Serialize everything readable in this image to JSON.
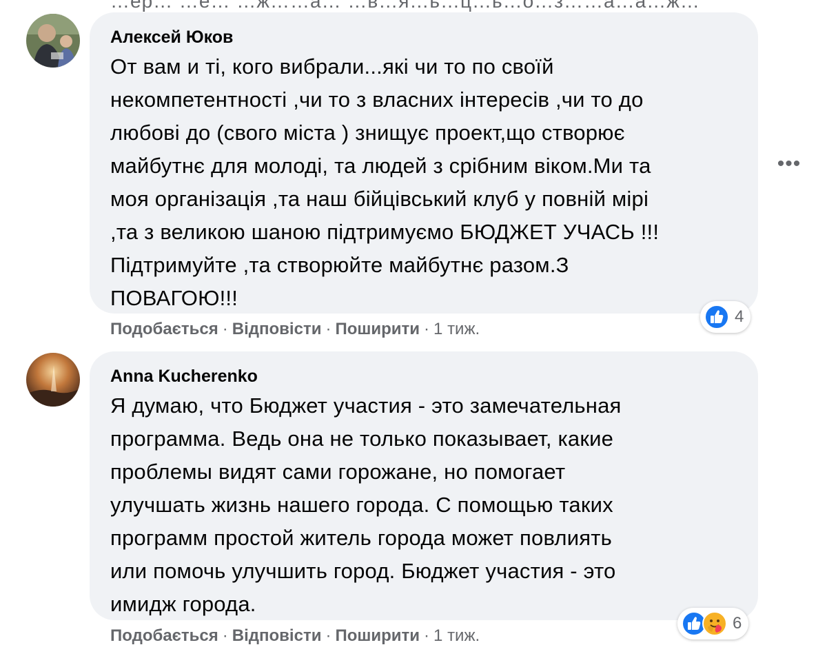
{
  "top_strip": "…ер… …е… …ж……а… …в…я…ь…ц…ь…о…з……а…а…ж…",
  "comments": [
    {
      "author": "Алексей Юков",
      "lines": [
        "От вам и ті, кого вибрали...які чи то по своїй",
        "некомпетентності ,чи то з власних інтересів ,чи то до",
        "любові до (свого міста ) знищує проект,що створює",
        "майбутнє для молоді, та людей з срібним віком.Ми та",
        "моя організація ,та наш бійцівський клуб у повній мірі",
        ",та з великою шаною підтримуємо БЮДЖЕТ УЧАСЬ !!!",
        "Підтримуйте ,та створюйте майбутнє разом.З",
        "ПОВАГОЮ!!!"
      ],
      "reaction_count": "4",
      "reaction_icons": [
        "like-icon"
      ],
      "actions": {
        "like": "Подобається",
        "reply": "Відповісти",
        "share": "Поширити",
        "separator": "·",
        "time": "1 тиж."
      }
    },
    {
      "author": "Anna Kucherenko",
      "lines": [
        "Я думаю, что Бюджет участия - это замечательная",
        "программа. Ведь она не только показывает, какие",
        "проблемы видят сами горожане, но помогает",
        "улучшать жизнь нашего города. С помощью таких",
        "программ простой житель города может повлиять",
        "или помочь улучшить город. Бюджет участия - это",
        "имидж города."
      ],
      "reaction_count": "6",
      "reaction_icons": [
        "like-icon",
        "care-icon"
      ],
      "actions": {
        "like": "Подобається",
        "reply": "Відповісти",
        "share": "Поширити",
        "separator": "·",
        "time": "1 тиж."
      }
    }
  ],
  "more_button": "•••",
  "colors": {
    "bubble": "#f0f2f5",
    "text": "#050505",
    "secondary": "#65676b",
    "like_blue": "#1877f2",
    "care_yellow": "#f7b125"
  }
}
